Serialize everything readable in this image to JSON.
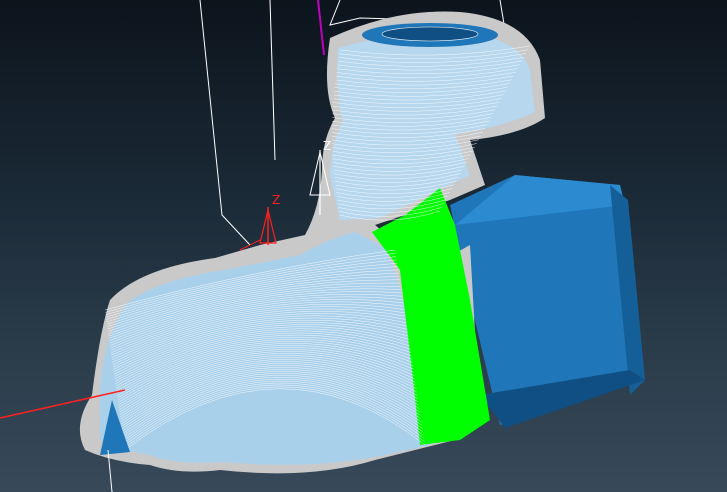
{
  "viewport": {
    "background_top": "#0c141c",
    "background_bottom": "#38495a"
  },
  "colors": {
    "stock_outline": "#c9c9c9",
    "toolpath_fill": "#a9d0ea",
    "toolpath_lines": "#ffffff",
    "fixture_blue": "#1f76b8",
    "fixture_blue_dark": "#0f4f83",
    "highlight_green": "#00ff00",
    "axis_red": "#ff2020",
    "axis_white": "#ffffff",
    "axis_magenta": "#c000c0"
  },
  "workplane_red": {
    "axis_label": "Z"
  },
  "workplane_white": {
    "axis_label": "Z"
  }
}
